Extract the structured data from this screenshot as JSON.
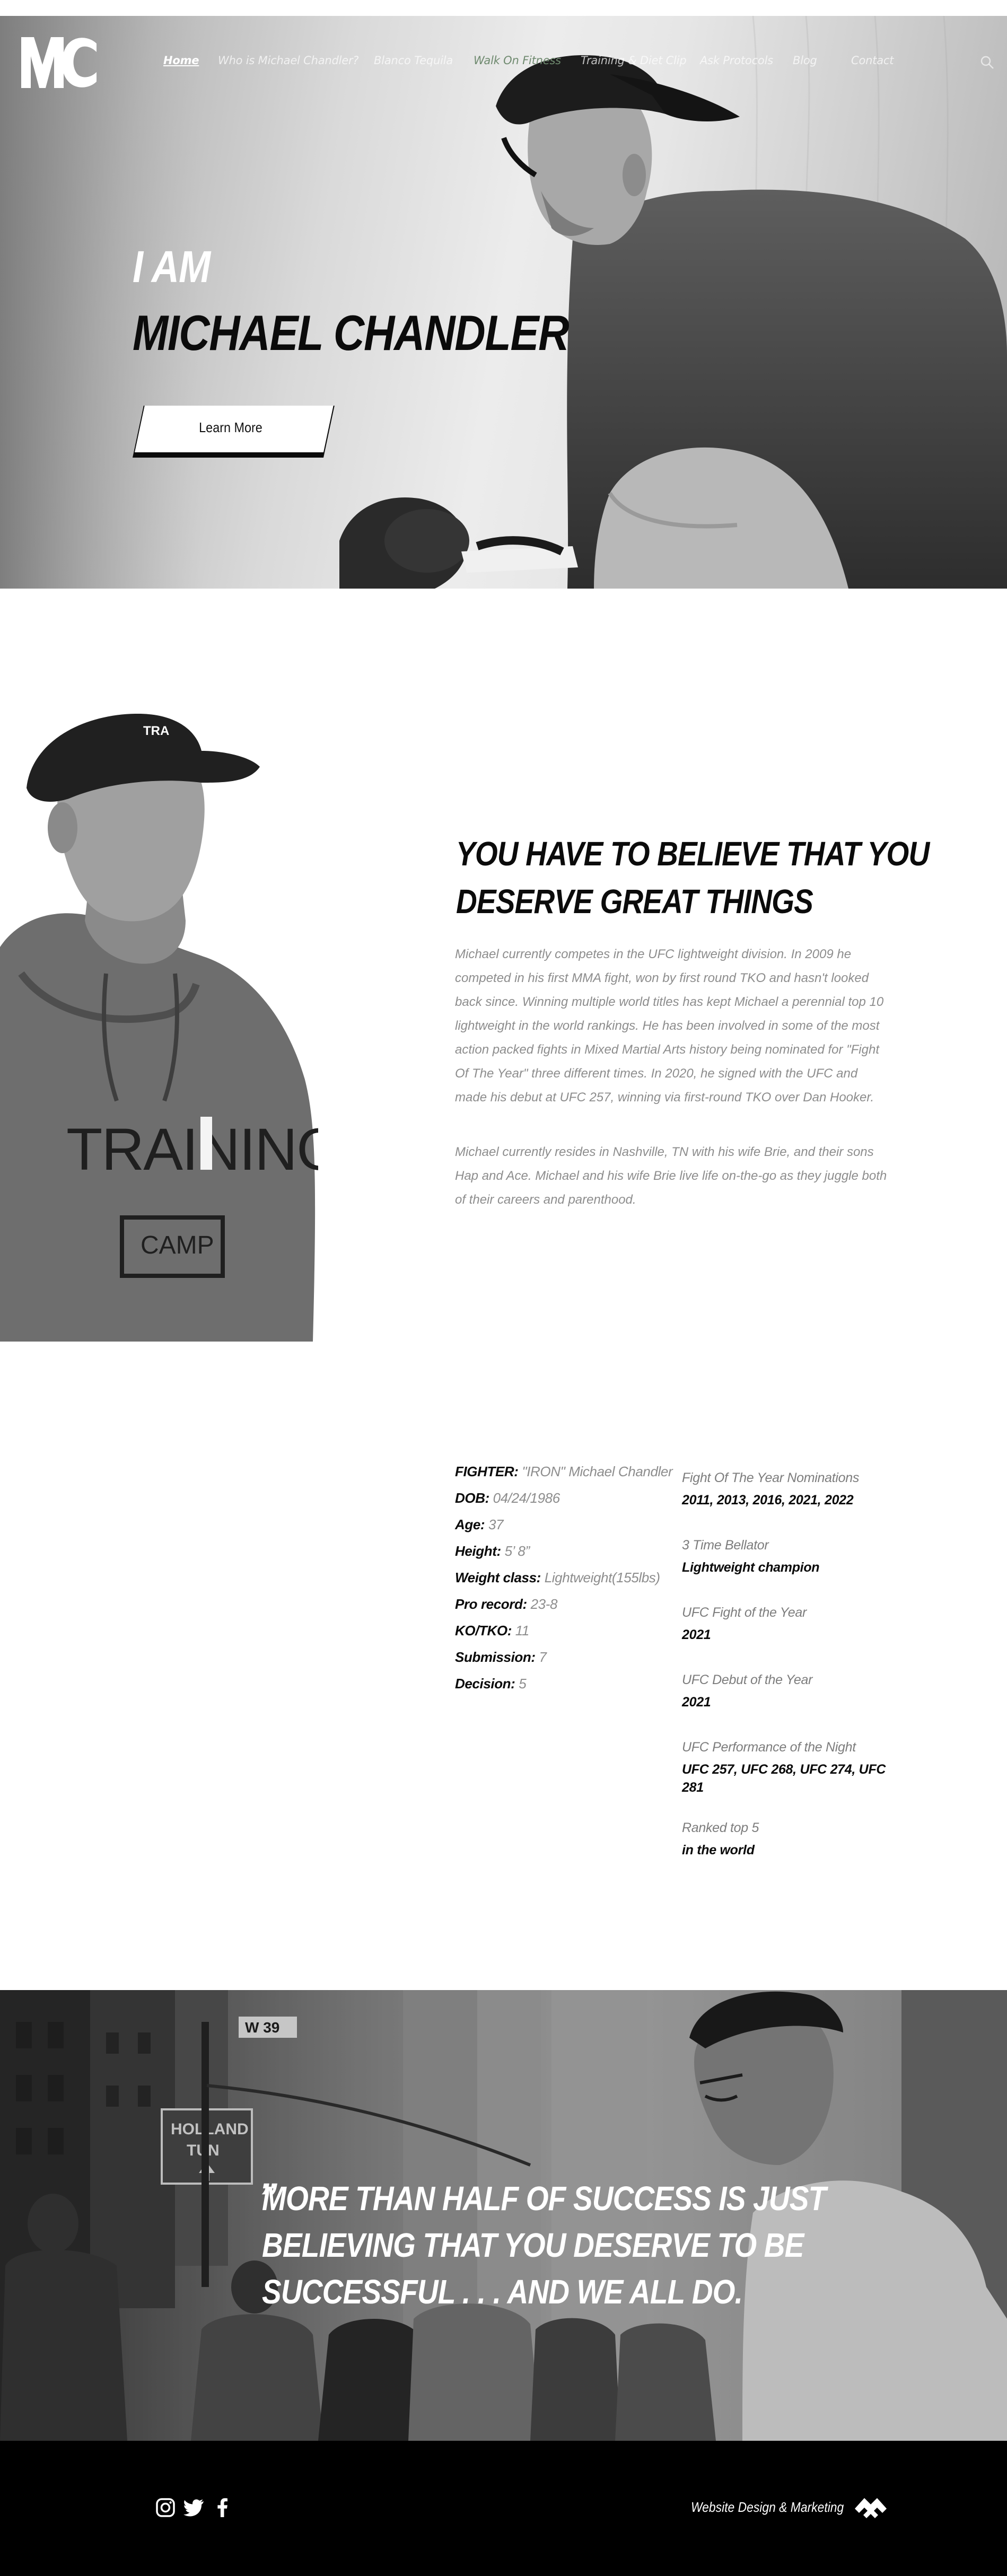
{
  "brand": {
    "logo_text": "MC"
  },
  "nav": {
    "items": [
      {
        "label": "Home",
        "active": true
      },
      {
        "label": "Who is Michael Chandler?"
      },
      {
        "label": "Blanco Tequila"
      },
      {
        "label": "Walk On Fitness",
        "highlight_color": "#6f8a6f"
      },
      {
        "label": "Training & Diet Clip"
      },
      {
        "label": "Ask Protocols"
      },
      {
        "label": "Blog"
      },
      {
        "label": "Contact"
      }
    ],
    "search_icon": "search-icon"
  },
  "hero": {
    "line1": "I AM",
    "line2": "MICHAEL CHANDLER",
    "cta": "Learn More"
  },
  "about": {
    "title_lines": [
      "YOU HAVE TO BELIEVE THAT YOU",
      "DESERVE GREAT THINGS"
    ],
    "paragraph1": "Michael currently competes in the UFC lightweight division. In 2009 he competed in his first MMA fight, won by first round TKO and hasn't looked back since. Winning multiple world titles has kept Michael a perennial top 10 lightweight in the world rankings. He has been involved in some of the most action packed fights in Mixed Martial Arts history being nominated for \"Fight Of The Year\" three different times. In 2020, he signed with the UFC and made his debut at UFC 257, winning via first-round TKO over Dan Hooker.",
    "paragraph2": "Michael currently resides in Nashville, TN with his wife Brie, and their sons Hap and Ace. Michael and his wife Brie live life on-the-go as they juggle both of their careers and parenthood."
  },
  "stats": {
    "fighter_k": "FIGHTER:",
    "fighter_v": "\"IRON\" Michael Chandler",
    "dob_k": "DOB:",
    "dob_v": "04/24/1986",
    "age_k": "Age:",
    "age_v": "37",
    "height_k": "Height:",
    "height_v": "5’ 8”",
    "weight_k": "Weight class:",
    "weight_v": "Lightweight(155lbs)",
    "record_k": "Pro record:",
    "record_v": "23-8",
    "ko_k": "KO/TKO:",
    "ko_v": "11",
    "sub_k": "Submission:",
    "sub_v": "7",
    "dec_k": "Decision:",
    "dec_v": "5"
  },
  "achievements": [
    {
      "title": "Fight Of The Year Nominations",
      "detail": "2011, 2013, 2016, 2021, 2022"
    },
    {
      "title": "3 Time Bellator",
      "detail": "Lightweight champion"
    },
    {
      "title": "UFC Fight of the Year",
      "detail": "2021"
    },
    {
      "title": "UFC Debut of the Year",
      "detail": "2021"
    },
    {
      "title": "UFC Performance of the Night",
      "detail": "UFC 257, UFC 268, UFC 274, UFC 281"
    },
    {
      "title": "Ranked top 5",
      "detail": "in the world"
    }
  ],
  "quote": {
    "mark": "„",
    "lines": [
      "MORE THAN HALF OF SUCCESS IS JUST",
      "BELIEVING THAT YOU DESERVE TO BE",
      "SUCCESSFUL . . . AND WE ALL DO."
    ],
    "street_sign_1": "W 39",
    "street_sign_2a": "HOLLAND",
    "street_sign_2b": "TUN"
  },
  "footer": {
    "social_icons": [
      "instagram-icon",
      "twitter-icon",
      "facebook-icon"
    ],
    "credit": "Website Design & Marketing",
    "agency_icon": "agency-logo-icon"
  },
  "colors": {
    "accent_green": "#6f8a6f",
    "dark": "#0b0b0b",
    "muted_text": "#8d8d8d",
    "footer_bg": "#000000"
  }
}
